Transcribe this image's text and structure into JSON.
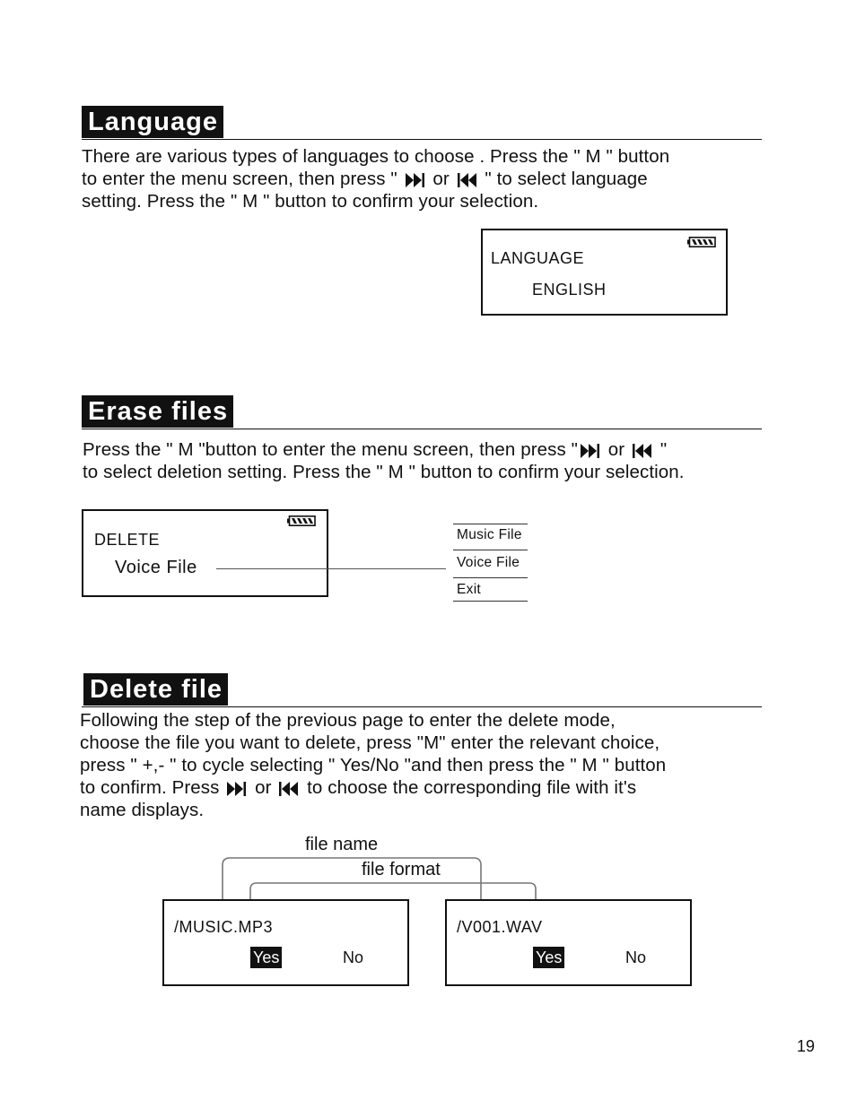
{
  "page_number": "19",
  "sections": {
    "language": {
      "title": "Language",
      "lines": [
        [
          "There are various types of languages to choose . Press the \" M \" button"
        ],
        [
          "to enter the menu screen, then press \" ",
          " or ",
          " \" to select language"
        ],
        [
          "setting. Press the \" M \" button to confirm your selection."
        ]
      ],
      "lcd": {
        "label": "LANGUAGE",
        "value": "ENGLISH",
        "battery_icon": "battery-full-icon"
      }
    },
    "erase": {
      "title": "Erase files",
      "lines": [
        [
          "Press the \" M \"button to enter the menu screen, then press \"",
          " or ",
          " \""
        ],
        [
          "to select deletion setting. Press the \" M \" button to confirm your selection."
        ]
      ],
      "lcd": {
        "label": "DELETE",
        "value": "Voice File",
        "battery_icon": "battery-full-icon"
      },
      "menu_options": [
        "Music File",
        "Voice File",
        "Exit"
      ]
    },
    "delete": {
      "title": "Delete file",
      "lines": [
        [
          "Following the step of the previous page to enter the delete mode,"
        ],
        [
          "choose the file you want to delete, press \"M\" enter the relevant choice,"
        ],
        [
          "press \" +,- \" to cycle selecting \" Yes/No \"and then press the \" M \" button"
        ],
        [
          "to confirm. Press ",
          " or ",
          " to choose the corresponding file with it's"
        ],
        [
          "name displays."
        ]
      ],
      "annotations": {
        "file_name": "file name",
        "file_format": "file format"
      },
      "screens": [
        {
          "filename": "/MUSIC.MP3",
          "yes": "Yes",
          "no": "No",
          "selected": "Yes"
        },
        {
          "filename": "/V001.WAV",
          "yes": "Yes",
          "no": "No",
          "selected": "Yes"
        }
      ]
    }
  },
  "icons": {
    "next": "skip-next-icon",
    "prev": "skip-previous-icon",
    "battery": "battery-full-icon"
  }
}
